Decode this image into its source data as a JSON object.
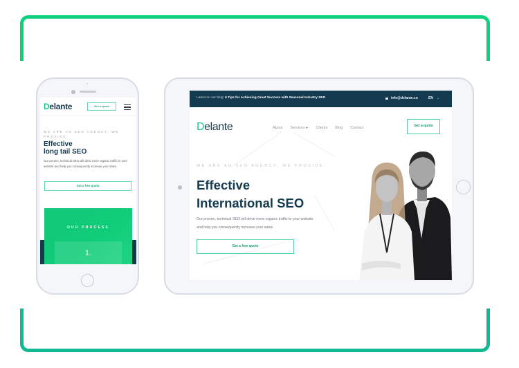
{
  "colors": {
    "bracket_top": "#0dd17e",
    "bracket_bottom": "#10b991",
    "brand_green": "#1fc88a",
    "navy": "#133a4f",
    "device_frame": "#f4f6fa"
  },
  "phone": {
    "logo": {
      "first_letter": "D",
      "rest": "elante"
    },
    "header_button": "Get a quote",
    "menu_icon": "hamburger-icon",
    "eyebrow": "WE ARE AN SEO AGENCY, WE PROVIDE:",
    "title_line1": "Effective",
    "title_line2": "long tail SEO",
    "description": "Our proven, technical SEO will drive more organic traffic to your website and help you consequently increase your sales.",
    "cta": "Get a free quote",
    "process_heading": "OUR PROCESS",
    "process_step": "1."
  },
  "tablet": {
    "topbar": {
      "blog_prefix": "Latest on our blog: ",
      "blog_title": "5 Tips for Achieving Great Success with Seasonal Industry SEO",
      "email_icon": "mail-icon",
      "email": "info@delante.co",
      "language": "EN",
      "language_caret": "⌄"
    },
    "logo": {
      "first_letter": "D",
      "rest": "elante"
    },
    "nav": [
      {
        "label": "About"
      },
      {
        "label": "Services",
        "has_dropdown": true
      },
      {
        "label": "Clients"
      },
      {
        "label": "Blog"
      },
      {
        "label": "Contact"
      }
    ],
    "nav_caret": "▼",
    "header_button": "Get a quote",
    "eyebrow": "WE ARE AN SEO AGENCY, WE PROVIDE:",
    "title_line1": "Effective",
    "title_line2": "International SEO",
    "description": "Our proven, technical SEO will drive more organic traffic to your website and help you consequently increase your sales.",
    "cta": "Get a free quote",
    "hero_image": "team-photo"
  }
}
